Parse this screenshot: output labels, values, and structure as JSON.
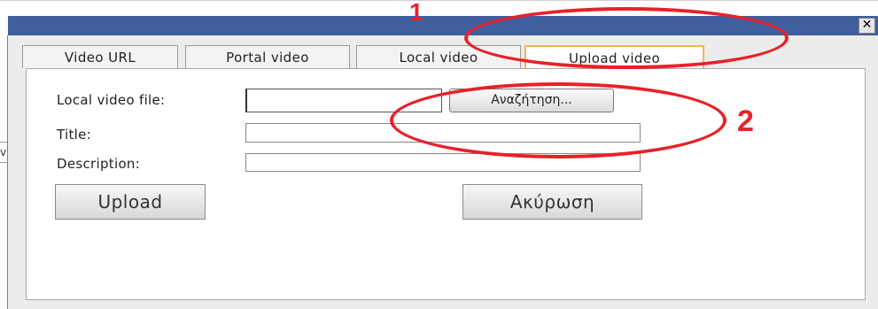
{
  "dialog": {
    "close_glyph": "✕",
    "tabs": [
      {
        "label": "Video URL"
      },
      {
        "label": "Portal video"
      },
      {
        "label": "Local video"
      },
      {
        "label": "Upload video",
        "active": true
      }
    ],
    "form": {
      "local_video_file_label": "Local video file:",
      "local_video_file_value": "",
      "browse_label": "Αναζήτηση...",
      "title_label": "Title:",
      "title_value": "",
      "description_label": "Description:",
      "description_value": ""
    },
    "buttons": {
      "upload_label": "Upload",
      "cancel_label": "Ακύρωση"
    }
  },
  "annotations": [
    {
      "number": "1"
    },
    {
      "number": "2"
    }
  ],
  "background": {
    "fragment_text": "v"
  },
  "colors": {
    "titlebar": "#3f5f9f",
    "active_tab_border": "#f0b64a",
    "annotation_red": "#e8212a"
  }
}
